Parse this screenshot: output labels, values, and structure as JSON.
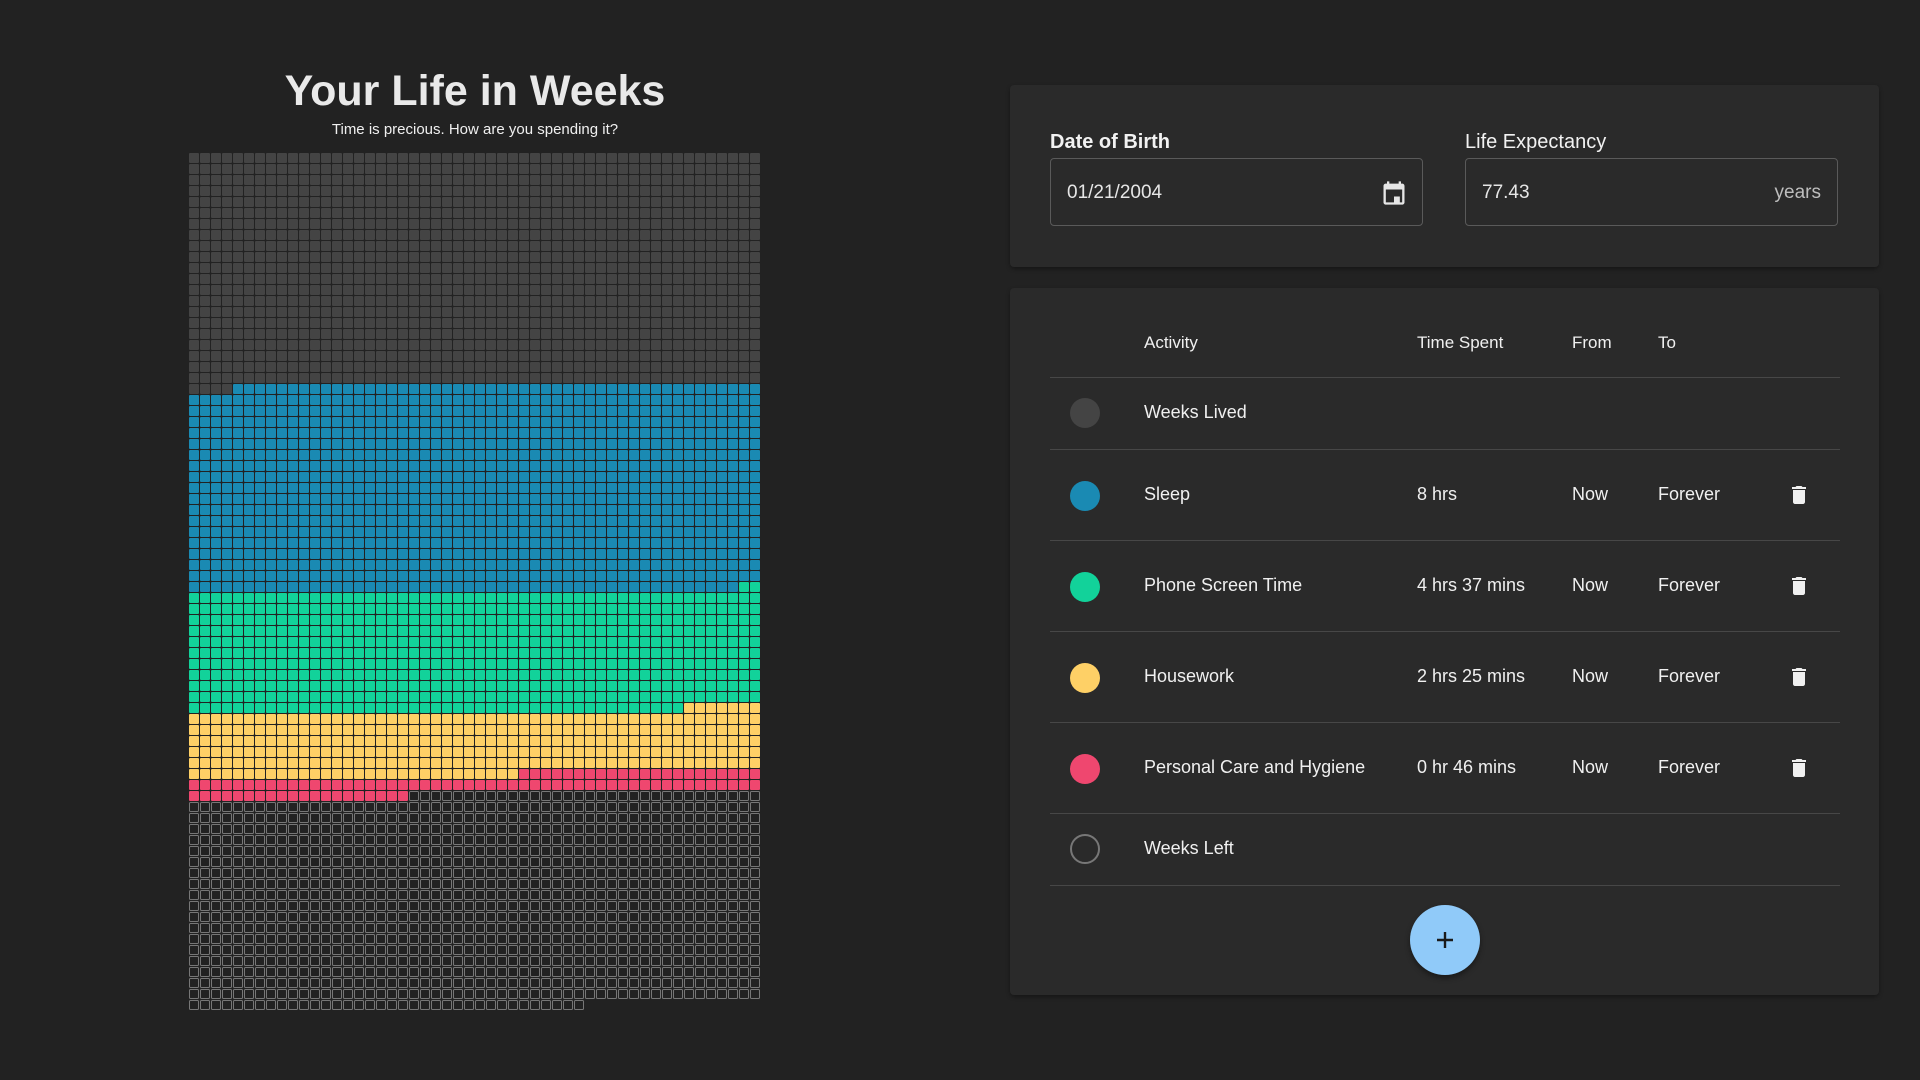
{
  "header": {
    "title": "Your Life in Weeks",
    "subtitle": "Time is precious. How are you spending it?"
  },
  "settings": {
    "dob_label": "Date of Birth",
    "dob_value": "01/21/2004",
    "life_expectancy_label": "Life Expectancy",
    "life_expectancy_value": "77.43",
    "life_expectancy_unit": "years"
  },
  "table": {
    "headers": {
      "activity": "Activity",
      "time_spent": "Time Spent",
      "from": "From",
      "to": "To"
    },
    "rows": [
      {
        "activity": "Weeks Lived",
        "time_spent": "",
        "from": "",
        "to": "",
        "color": "#444444",
        "deletable": false,
        "outline": false
      },
      {
        "activity": "Sleep",
        "time_spent": "8 hrs",
        "from": "Now",
        "to": "Forever",
        "color": "#1a8ab3",
        "deletable": true,
        "outline": false
      },
      {
        "activity": "Phone Screen Time",
        "time_spent": "4 hrs 37 mins",
        "from": "Now",
        "to": "Forever",
        "color": "#12d29a",
        "deletable": true,
        "outline": false
      },
      {
        "activity": "Housework",
        "time_spent": "2 hrs 25 mins",
        "from": "Now",
        "to": "Forever",
        "color": "#fed066",
        "deletable": true,
        "outline": false
      },
      {
        "activity": "Personal Care and Hygiene",
        "time_spent": "0 hr 46 mins",
        "from": "Now",
        "to": "Forever",
        "color": "#ef476f",
        "deletable": true,
        "outline": false
      },
      {
        "activity": "Weeks Left",
        "time_spent": "",
        "from": "",
        "to": "",
        "color": "#777777",
        "deletable": false,
        "outline": true
      }
    ]
  },
  "grid": {
    "columns": 52,
    "total_weeks": 4040,
    "segments": [
      {
        "activity": "Weeks Lived",
        "weeks": 1096,
        "color": "#444444",
        "outline": false
      },
      {
        "activity": "Sleep",
        "weeks": 982,
        "color": "#1a8ab3",
        "outline": false
      },
      {
        "activity": "Phone Screen Time",
        "weeks": 567,
        "color": "#12d29a",
        "outline": false
      },
      {
        "activity": "Housework",
        "weeks": 297,
        "color": "#fed066",
        "outline": false
      },
      {
        "activity": "Personal Care and Hygiene",
        "weeks": 94,
        "color": "#ef476f",
        "outline": false
      },
      {
        "activity": "Weeks Left",
        "weeks": 1004,
        "color": "#777777",
        "outline": true
      }
    ]
  }
}
